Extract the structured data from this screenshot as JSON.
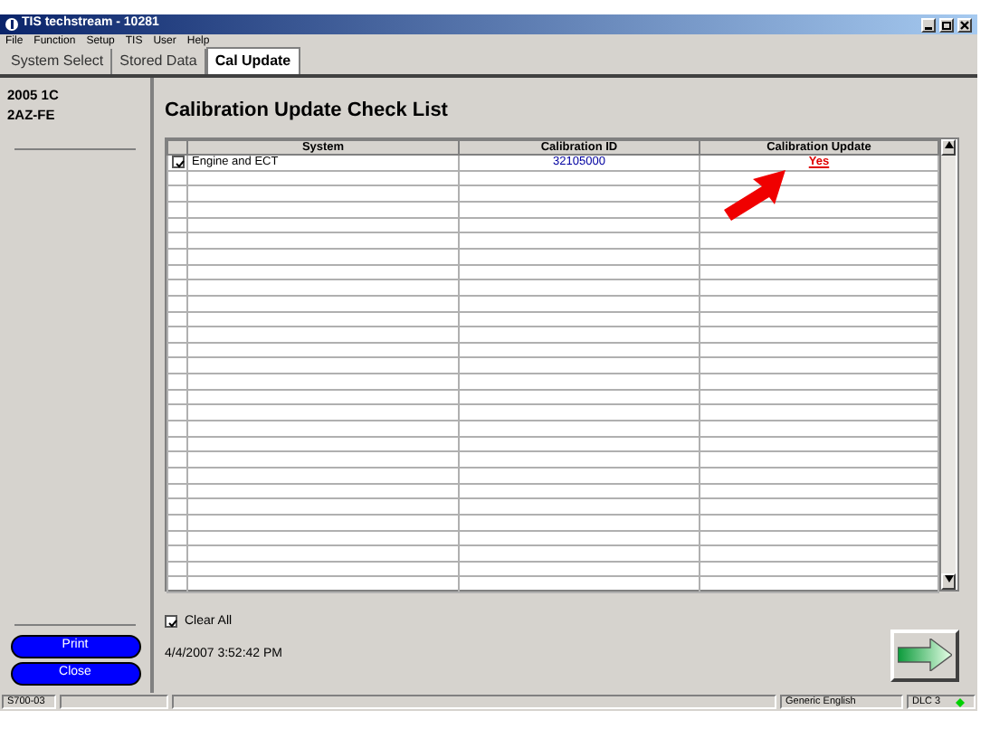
{
  "window": {
    "title": "TIS techstream - 10281"
  },
  "menu": [
    "File",
    "Function",
    "Setup",
    "TIS",
    "User",
    "Help"
  ],
  "tabs": [
    {
      "label": "System Select",
      "selected": false
    },
    {
      "label": "Stored Data",
      "selected": false
    },
    {
      "label": "Cal Update",
      "selected": true
    }
  ],
  "vehicle": [
    "2005 1C",
    "2AZ-FE"
  ],
  "side_buttons": [
    "Print",
    "Close"
  ],
  "page_title": "Calibration Update Check List",
  "table": {
    "columns": [
      "System",
      "Calibration ID",
      "Calibration Update"
    ],
    "rows": [
      {
        "checked": true,
        "system": "Engine and ECT",
        "calibration_id": "32105000",
        "calibration_update": "Yes"
      }
    ]
  },
  "clear_all": {
    "label": "Clear All",
    "checked": true
  },
  "timestamp": "4/4/2007 3:52:42 PM",
  "status_bar": {
    "code": "S700-03",
    "language": "Generic English",
    "link": "DLC 3"
  }
}
